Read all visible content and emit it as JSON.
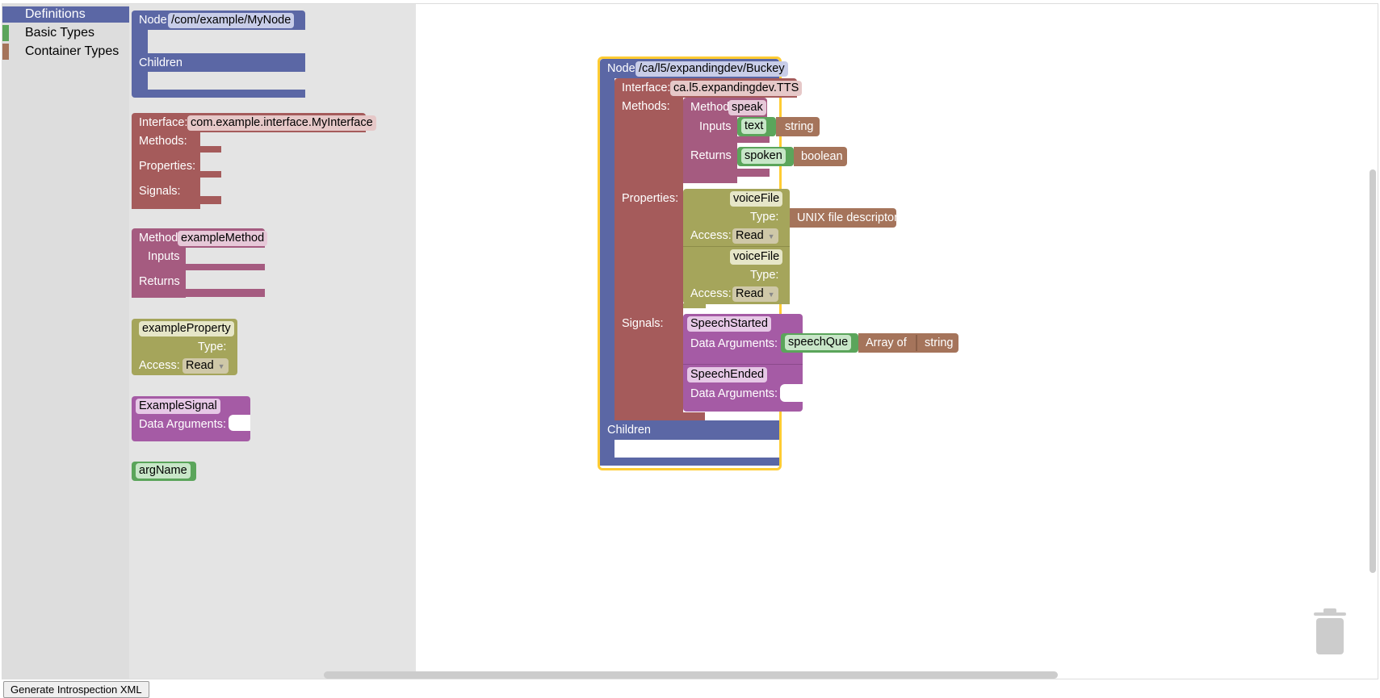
{
  "toolbox": {
    "categories": [
      {
        "label": "Definitions",
        "color": "#5b67a5",
        "selected": true
      },
      {
        "label": "Basic Types",
        "color": "#5ba55b"
      },
      {
        "label": "Container Types",
        "color": "#a5745b"
      }
    ]
  },
  "flyout": {
    "node": {
      "keyword": "Node",
      "path": "/com/example/MyNode",
      "children": "Children"
    },
    "interface": {
      "keyword": "Interface:",
      "name": "com.example.interface.MyInterface",
      "methods": "Methods:",
      "properties": "Properties:",
      "signals": "Signals:"
    },
    "method": {
      "keyword": "Method",
      "name": "exampleMethod",
      "inputs": "Inputs",
      "returns": "Returns"
    },
    "property": {
      "name": "exampleProperty",
      "type": "Type:",
      "access": "Access:",
      "access_value": "Read"
    },
    "signal": {
      "name": "ExampleSignal",
      "data_args": "Data Arguments:"
    },
    "arg": {
      "name": "argName"
    }
  },
  "workspace": {
    "node": {
      "keyword": "Node",
      "path": "/ca/l5/expandingdev/Buckey",
      "children": "Children"
    },
    "interface": {
      "keyword": "Interface:",
      "name": "ca.l5.expandingdev.TTS",
      "methods": "Methods:",
      "properties": "Properties:",
      "signals": "Signals:"
    },
    "method": {
      "keyword": "Method",
      "name": "speak",
      "inputs": "Inputs",
      "input_arg": "text",
      "input_type": "string",
      "returns": "Returns",
      "return_arg": "spoken",
      "return_type": "boolean"
    },
    "property1": {
      "name": "voiceFile",
      "type": "Type:",
      "type_value": "UNIX file descriptor",
      "access": "Access:",
      "access_value": "Read"
    },
    "property2": {
      "name": "voiceFile",
      "type": "Type:",
      "access": "Access:",
      "access_value": "Read"
    },
    "signal1": {
      "name": "SpeechStarted",
      "data_args": "Data Arguments:",
      "arg": "speechQue",
      "array_of": "Array of",
      "elem_type": "string"
    },
    "signal2": {
      "name": "SpeechEnded",
      "data_args": "Data Arguments:"
    }
  },
  "footer": {
    "generate_button": "Generate Introspection XML"
  },
  "colors": {
    "node": "#5b67a5",
    "interface": "#a55b5b",
    "method": "#a55b80",
    "property": "#a5a55b",
    "signal": "#a55ba5",
    "arg": "#5ba55b",
    "type": "#a5745b",
    "selected": "#fc3"
  }
}
